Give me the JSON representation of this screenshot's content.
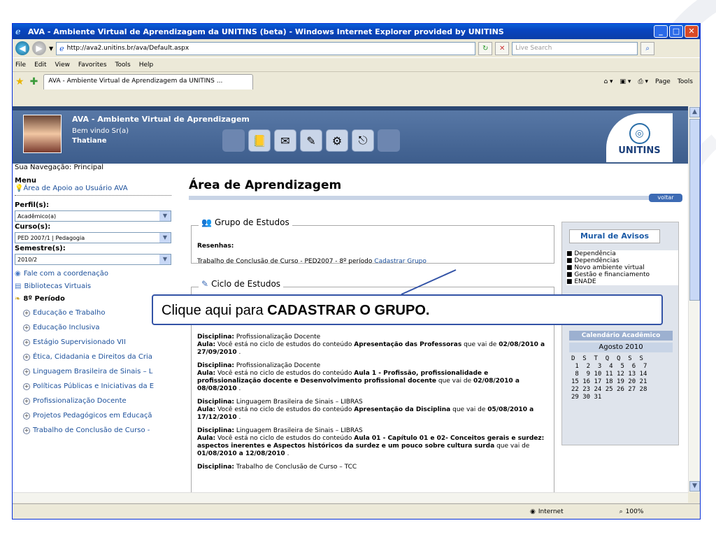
{
  "window": {
    "title": "AVA - Ambiente Virtual de Aprendizagem da UNITINS (beta) - Windows Internet Explorer provided by UNITINS"
  },
  "addressbar": {
    "url": "http://ava2.unitins.br/ava/Default.aspx",
    "search_placeholder": "Live Search"
  },
  "menubar": [
    "File",
    "Edit",
    "View",
    "Favorites",
    "Tools",
    "Help"
  ],
  "favbar": {
    "tab_title": "AVA - Ambiente Virtual de Aprendizagem da UNITINS ...",
    "page_label": "Page",
    "tools_label": "Tools"
  },
  "header": {
    "title": "AVA - Ambiente Virtual de Aprendizagem",
    "welcome": "Bem vindo Sr(a)",
    "user": "Thatiane",
    "logo_text": "UNITINS"
  },
  "subnav": "Sua Navegação: Principal",
  "sidebar": {
    "menu_label": "Menu",
    "support_link": "Área de Apoio ao Usuário AVA",
    "perfil_label": "Perfil(s):",
    "perfil_value": "Acadêmico(a)",
    "curso_label": "Curso(s):",
    "curso_value": "PED 2007/1 | Pedagogia",
    "semestre_label": "Semestre(s):",
    "semestre_value": "2010/2",
    "contact": "Fale com a coordenação",
    "libraries": "Bibliotecas Virtuais",
    "period": "8º Período",
    "subjects": [
      "Educação e Trabalho",
      "Educação Inclusiva",
      "Estágio Supervisionado VII",
      "Ética, Cidadania e Direitos da Cria",
      "Linguagem Brasileira de Sinais – L",
      "Políticas Públicas e Iniciativas da E",
      "Profissionalização Docente",
      "Projetos Pedagógicos em Educaçã",
      "Trabalho de Conclusão de Curso -"
    ]
  },
  "main": {
    "title": "Área de Aprendizagem",
    "voltar": "voltar",
    "grupo_legend": "Grupo de Estudos",
    "resenhas": "Resenhas:",
    "tcc_text": "Trabalho de Conclusão de Curso - PED2007 - 8º período",
    "cadastrar_link": "Cadastrar Grupo",
    "ciclo_legend": "Ciclo de Estudos",
    "disciplinas": [
      {
        "label": "Disciplina:",
        "name": "Profissionalização Docente",
        "aula_label": "Aula:",
        "pre": "Você está no ciclo de estudos do conteúdo",
        "bold": "Apresentação das Professoras",
        "mid": "que vai de",
        "dates": "02/08/2010 a 27/09/2010",
        "end": "."
      },
      {
        "label": "Disciplina:",
        "name": "Profissionalização Docente",
        "aula_label": "Aula:",
        "pre": "Você está no ciclo de estudos do conteúdo",
        "bold": "Aula 1 - Profissão, profissionalidade e profissionalização docente e Desenvolvimento profissional docente",
        "mid": "que vai de",
        "dates": "02/08/2010 a 08/08/2010",
        "end": "."
      },
      {
        "label": "Disciplina:",
        "name": "Linguagem Brasileira de Sinais – LIBRAS",
        "aula_label": "Aula:",
        "pre": "Você está no ciclo de estudos do conteúdo",
        "bold": "Apresentação da Disciplina",
        "mid": "que vai de",
        "dates": "05/08/2010 a 17/12/2010",
        "end": "."
      },
      {
        "label": "Disciplina:",
        "name": "Linguagem Brasileira de Sinais – LIBRAS",
        "aula_label": "Aula:",
        "pre": "Você está no ciclo de estudos do conteúdo",
        "bold": "Aula 01 - Capítulo 01 e 02- Conceitos gerais e surdez: aspectos inerentes e Aspectos históricos da surdez e um pouco sobre cultura surda",
        "mid": "que vai de",
        "dates": "01/08/2010 a 12/08/2010",
        "end": "."
      },
      {
        "label": "Disciplina:",
        "name": "Trabalho de Conclusão de Curso – TCC",
        "aula_label": "",
        "pre": "",
        "bold": "",
        "mid": "",
        "dates": "",
        "end": ""
      }
    ]
  },
  "mural": {
    "title": "Mural de Avisos",
    "items": [
      "Dependência",
      "Dependências",
      "Novo ambiente virtual",
      "Gestão e financiamento",
      "ENADE"
    ],
    "calendar_title": "Calendário Acadêmico",
    "month": "Agosto 2010",
    "weekdays": "D  S  T  Q  Q  S  S",
    "weeks": [
      " 1  2  3  4  5  6  7",
      " 8  9 10 11 12 13 14",
      "15 16 17 18 19 20 21",
      "22 23 24 25 26 27 28",
      "29 30 31"
    ]
  },
  "callout": {
    "pre": "Clique aqui para ",
    "bold": "CADASTRAR O GRUPO."
  },
  "statusbar": {
    "zone": "Internet",
    "zoom": "100%"
  }
}
